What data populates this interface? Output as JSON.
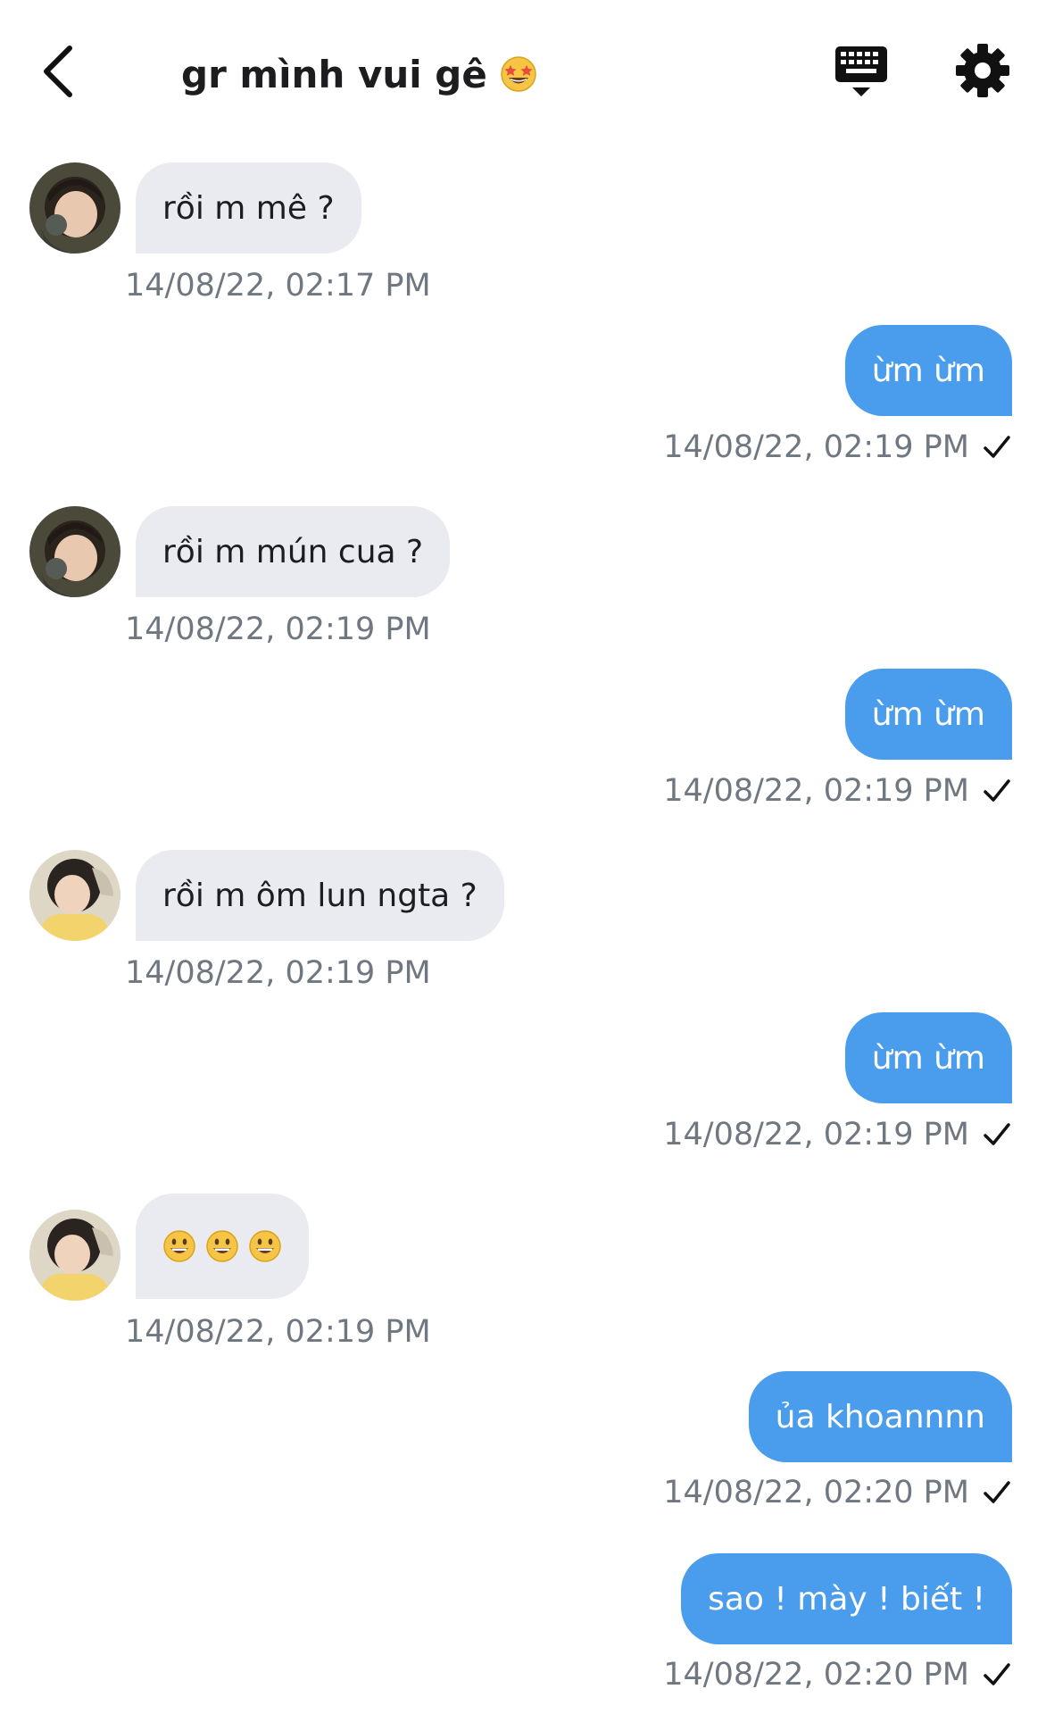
{
  "header": {
    "title": "gr mình vui gê",
    "title_emoji": "star-struck-emoji",
    "back_icon": "chevron-left-icon",
    "keyboard_icon": "keyboard-icon",
    "settings_icon": "gear-icon"
  },
  "colors": {
    "outgoing_bubble": "#4a9ced",
    "incoming_bubble": "#e9ebf0",
    "timestamp": "#6f7780"
  },
  "messages": [
    {
      "direction": "in",
      "text": "rồi m mê ?",
      "time": "14/08/22, 02:17 PM"
    },
    {
      "direction": "out",
      "text": "ừm ừm",
      "time": "14/08/22, 02:19 PM"
    },
    {
      "direction": "in",
      "text": "rồi m mún cua ?",
      "time": "14/08/22, 02:19 PM"
    },
    {
      "direction": "out",
      "text": "ừm ừm",
      "time": "14/08/22, 02:19 PM"
    },
    {
      "direction": "in",
      "text": "rồi m ôm lun ngta ?",
      "time": "14/08/22, 02:19 PM"
    },
    {
      "direction": "out",
      "text": "ừm ừm",
      "time": "14/08/22, 02:19 PM"
    },
    {
      "direction": "in",
      "emoji": [
        "grinning-face-emoji",
        "grinning-face-emoji",
        "grinning-face-emoji"
      ],
      "time": "14/08/22, 02:19 PM"
    },
    {
      "direction": "out",
      "text": "ủa khoannnn",
      "time": "14/08/22, 02:20 PM"
    },
    {
      "direction": "out",
      "text": "sao ! mày ! biết !",
      "time": "14/08/22, 02:20 PM"
    }
  ]
}
